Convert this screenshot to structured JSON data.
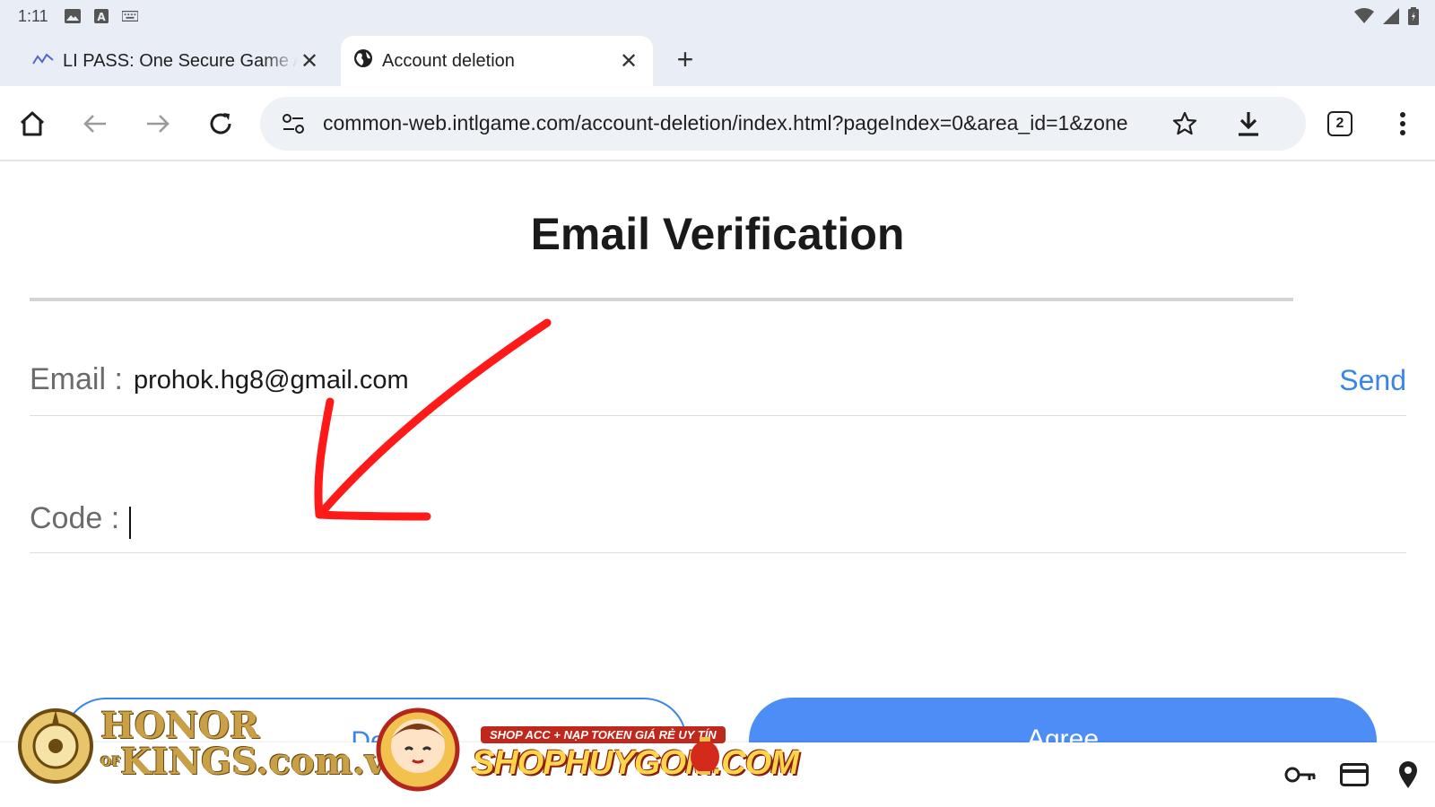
{
  "status_bar": {
    "time": "1:11",
    "left_icons": [
      "image-icon",
      "a-box-icon",
      "keyboard-icon"
    ],
    "right_icons": [
      "wifi-icon",
      "signal-icon",
      "battery-icon"
    ]
  },
  "tabs": [
    {
      "title": "LI PASS: One Secure Game A",
      "icon": "lipass-logo-icon",
      "active": false
    },
    {
      "title": "Account deletion",
      "icon": "globe-icon",
      "active": true
    }
  ],
  "toolbar": {
    "url": "common-web.intlgame.com/account-deletion/index.html?pageIndex=0&area_id=1&zone",
    "tab_count": "2"
  },
  "page": {
    "title": "Email Verification",
    "email_label": "Email :",
    "email_value": "prohok.hg8@gmail.com",
    "send_label": "Send",
    "code_label": "Code :",
    "code_value": "",
    "decline_label": "Dec",
    "agree_label": "Agree"
  },
  "watermark": {
    "logo_line1": "HONOR",
    "logo_of": "OF",
    "logo_line2": "KINGS.com.vn",
    "tagline": "SHOP ACC + NẠP TOKEN GIÁ RẺ UY TÍN",
    "brand": "SHOPHUYGOM.COM"
  },
  "colors": {
    "accent": "#3a86e8",
    "agree_button": "#4c8ef6",
    "arrow": "#ff1a1a",
    "chrome_bg": "#e9eef6"
  }
}
